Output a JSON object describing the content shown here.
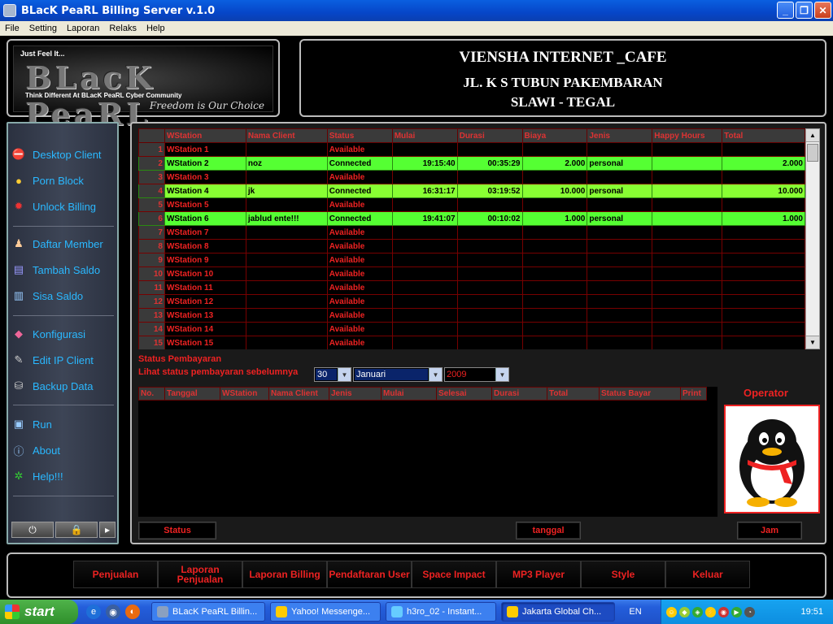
{
  "window": {
    "title": "BLacK PeaRL Billing Server v.1.0"
  },
  "menu": [
    "File",
    "Setting",
    "Laporan",
    "Relaks",
    "Help"
  ],
  "logo": {
    "tagline": "Just Feel It...",
    "mark": "BLacK PeaRL",
    "subtitle": "Think Different At BLacK PeaRL Cyber Community",
    "motto": "Freedom is Our Choice"
  },
  "cafe": {
    "name": "VIENSHA INTERNET _CAFE",
    "address1": "JL. K S TUBUN PAKEMBARAN",
    "address2": "SLAWI - TEGAL"
  },
  "sidebar": {
    "items": [
      {
        "label": "Desktop Client",
        "icon": "no-entry-icon",
        "color": "#e33"
      },
      {
        "label": "Porn Block",
        "icon": "person-icon",
        "color": "#fc3"
      },
      {
        "label": "Unlock Billing",
        "icon": "bug-icon",
        "color": "#e33"
      },
      {
        "label": "Daftar Member",
        "icon": "members-icon",
        "color": "#fc9"
      },
      {
        "label": "Tambah Saldo",
        "icon": "document-add-icon",
        "color": "#99f"
      },
      {
        "label": "Sisa Saldo",
        "icon": "document-icon",
        "color": "#9cf"
      },
      {
        "label": "Konfigurasi",
        "icon": "config-icon",
        "color": "#e69"
      },
      {
        "label": "Edit IP Client",
        "icon": "edit-icon",
        "color": "#ccc"
      },
      {
        "label": "Backup Data",
        "icon": "database-icon",
        "color": "#ccc"
      },
      {
        "label": "Run",
        "icon": "window-icon",
        "color": "#9cf"
      },
      {
        "label": "About",
        "icon": "info-icon",
        "color": "#9cf"
      },
      {
        "label": "Help!!!",
        "icon": "help-icon",
        "color": "#3c3"
      }
    ]
  },
  "stations": {
    "columns": [
      "",
      "WStation",
      "Nama Client",
      "Status",
      "Mulai",
      "Durasi",
      "Biaya",
      "Jenis",
      "Happy Hours",
      "Total"
    ],
    "rows": [
      [
        "1",
        "WStation 1",
        "",
        "Available",
        "",
        "",
        "",
        "",
        "",
        ""
      ],
      [
        "2",
        "WStation 2",
        "noz",
        "Connected",
        "19:15:40",
        "00:35:29",
        "2.000",
        "personal",
        "",
        "2.000"
      ],
      [
        "3",
        "WStation 3",
        "",
        "Available",
        "",
        "",
        "",
        "",
        "",
        ""
      ],
      [
        "4",
        "WStation 4",
        "jk",
        "Connected",
        "16:31:17",
        "03:19:52",
        "10.000",
        "personal",
        "",
        "10.000"
      ],
      [
        "5",
        "WStation 5",
        "",
        "Available",
        "",
        "",
        "",
        "",
        "",
        ""
      ],
      [
        "6",
        "WStation 6",
        "jablud ente!!!",
        "Connected",
        "19:41:07",
        "00:10:02",
        "1.000",
        "personal",
        "",
        "1.000"
      ],
      [
        "7",
        "WStation 7",
        "",
        "Available",
        "",
        "",
        "",
        "",
        "",
        ""
      ],
      [
        "8",
        "WStation 8",
        "",
        "Available",
        "",
        "",
        "",
        "",
        "",
        ""
      ],
      [
        "9",
        "WStation 9",
        "",
        "Available",
        "",
        "",
        "",
        "",
        "",
        ""
      ],
      [
        "10",
        "WStation 10",
        "",
        "Available",
        "",
        "",
        "",
        "",
        "",
        ""
      ],
      [
        "11",
        "WStation 11",
        "",
        "Available",
        "",
        "",
        "",
        "",
        "",
        ""
      ],
      [
        "12",
        "WStation 12",
        "",
        "Available",
        "",
        "",
        "",
        "",
        "",
        ""
      ],
      [
        "13",
        "WStation 13",
        "",
        "Available",
        "",
        "",
        "",
        "",
        "",
        ""
      ],
      [
        "14",
        "WStation 14",
        "",
        "Available",
        "",
        "",
        "",
        "",
        "",
        ""
      ],
      [
        "15",
        "WStation 15",
        "",
        "Available",
        "",
        "",
        "",
        "",
        "",
        ""
      ]
    ]
  },
  "payment": {
    "title": "Status Pembayaran",
    "prev_label": "Lihat status pembayaran sebelumnya",
    "day": "30",
    "month": "Januari",
    "year": "2009",
    "columns": [
      "No.",
      "Tanggal",
      "WStation",
      "Nama Client",
      "Jenis",
      "Mulai",
      "Selesai",
      "Durasi",
      "Total",
      "Status Bayar",
      "Print"
    ]
  },
  "operator": {
    "label": "Operator",
    "avatar": "penguin-icon"
  },
  "buttons": {
    "status": "Status",
    "tanggal": "tanggal",
    "jam": "Jam"
  },
  "nav": [
    "Penjualan",
    "Laporan Penjualan",
    "Laporan Billing",
    "Pendaftaran User",
    "Space Impact",
    "MP3 Player",
    "Style",
    "Keluar"
  ],
  "taskbar": {
    "start": "start",
    "tasks": [
      {
        "label": "BLacK PeaRL Billin...",
        "color": "#8aa0c0"
      },
      {
        "label": "Yahoo! Messenge...",
        "color": "#fc0"
      },
      {
        "label": "h3ro_02 - Instant...",
        "color": "#6cf"
      },
      {
        "label": "Jakarta Global Ch...",
        "color": "#fc0"
      }
    ],
    "lang": "EN",
    "clock": "19:51"
  }
}
